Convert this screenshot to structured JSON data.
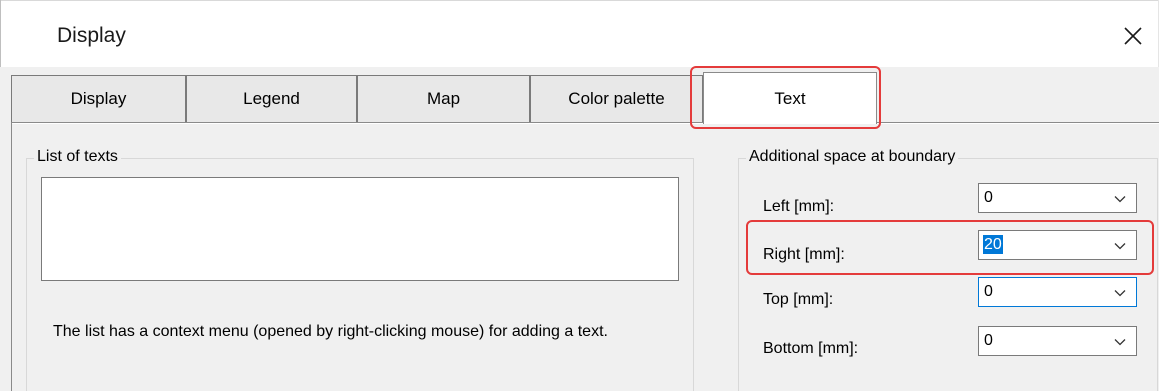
{
  "window": {
    "title": "Display"
  },
  "tabs": [
    {
      "label": "Display"
    },
    {
      "label": "Legend"
    },
    {
      "label": "Map"
    },
    {
      "label": "Color palette"
    },
    {
      "label": "Text"
    }
  ],
  "texts_group": {
    "title": "List of texts",
    "description": "The list has a context menu (opened by right-clicking mouse) for adding a text."
  },
  "boundary_group": {
    "title": "Additional space at boundary",
    "fields": [
      {
        "label": "Left [mm]:",
        "value": "0"
      },
      {
        "label": "Right [mm]:",
        "value": "20"
      },
      {
        "label": "Top [mm]:",
        "value": "0"
      },
      {
        "label": "Bottom [mm]:",
        "value": "0"
      }
    ]
  },
  "colors": {
    "highlight": "#e43b3b",
    "selection": "#0078d7"
  },
  "icons": {
    "close": "close-icon",
    "dropdown": "chevron-down-icon"
  }
}
